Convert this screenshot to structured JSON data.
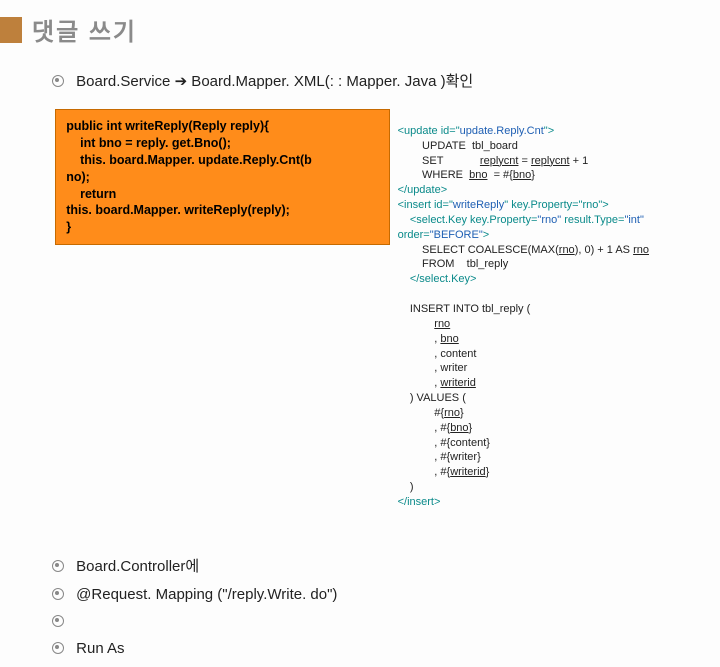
{
  "title": "댓글 쓰기",
  "topline": {
    "a": "Board.Service ",
    "arrow": "➔",
    "b": " Board.Mapper. XML(: : Mapper. Java )확인"
  },
  "javaCode": "public int writeReply(Reply reply){\n    int bno = reply. get.Bno();\n    this. board.Mapper. update.Reply.Cnt(b\nno);\n    return\nthis. board.Mapper. writeReply(reply);\n}",
  "bullets": {
    "b1": "Board.Controller에",
    "b2": "@Request. Mapping (\"/reply.Write. do\")",
    "b3": "",
    "b4": "Run As"
  },
  "xml": {
    "l1a": "<update id=\"",
    "l1b": "update.Reply.Cnt",
    "l1c": "\">",
    "l2": "        UPDATE  tbl_board",
    "l3a": "        SET            ",
    "l3b": "replycnt",
    "l3c": " = ",
    "l3d": "replycnt",
    "l3e": " + 1",
    "l4a": "        WHERE  ",
    "l4b": "bno",
    "l4c": "  = #{",
    "l4d": "bno",
    "l4e": "}",
    "l5": "</update>",
    "l6a": "<insert id=\"",
    "l6b": "writeReply",
    "l6c": "\" key.Property=\"rno\">",
    "l7a": "    <select.Key key.Property=",
    "l7b": "\"rno\"",
    "l7c": " result.Type=",
    "l7d": "\"int\"",
    "l8a": "order=",
    "l8b": "\"BEFORE\"",
    "l8c": ">",
    "l9a": "        SELECT COALESCE(MAX(",
    "l9b": "rno",
    "l9c": "), 0) + 1 AS ",
    "l9d": "rno",
    "l10": "        FROM    tbl_reply",
    "l11": "    </select.Key>",
    "l12": "",
    "l13": "    INSERT INTO tbl_reply (",
    "l14a": "            ",
    "l14b": "rno",
    "l15a": "            , ",
    "l15b": "bno",
    "l16": "            , content",
    "l17": "            , writer",
    "l18a": "            , ",
    "l18b": "writerid",
    "l19": "    ) VALUES (",
    "l20a": "            #{",
    "l20b": "rno",
    "l20c": "}",
    "l21a": "            , #{",
    "l21b": "bno",
    "l21c": "}",
    "l22": "            , #{content}",
    "l23": "            , #{writer}",
    "l24a": "            , #{",
    "l24b": "writerid",
    "l24c": "}",
    "l25": "    )",
    "l26": "</insert>"
  }
}
